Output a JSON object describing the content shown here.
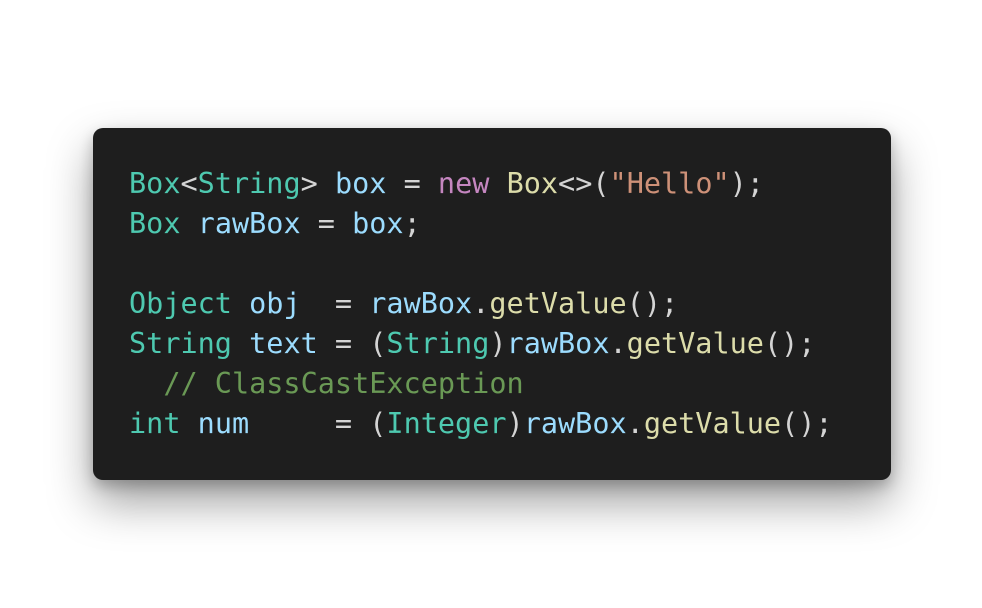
{
  "colors": {
    "background": "#1e1e1e",
    "type": "#4ec9b0",
    "variable": "#9cdcfe",
    "keyword": "#c586c0",
    "function": "#dcdcaa",
    "string": "#ce9178",
    "operator": "#d4d4d4",
    "comment": "#6a9955"
  },
  "code": {
    "lines": [
      [
        {
          "t": "Box",
          "k": "type"
        },
        {
          "t": "<",
          "k": "op"
        },
        {
          "t": "String",
          "k": "type"
        },
        {
          "t": "> ",
          "k": "op"
        },
        {
          "t": "box",
          "k": "var"
        },
        {
          "t": " = ",
          "k": "op"
        },
        {
          "t": "new",
          "k": "kw"
        },
        {
          "t": " ",
          "k": "op"
        },
        {
          "t": "Box",
          "k": "fn"
        },
        {
          "t": "<>(",
          "k": "op"
        },
        {
          "t": "\"Hello\"",
          "k": "str"
        },
        {
          "t": ");",
          "k": "op"
        }
      ],
      [
        {
          "t": "Box",
          "k": "type"
        },
        {
          "t": " ",
          "k": "op"
        },
        {
          "t": "rawBox",
          "k": "var"
        },
        {
          "t": " = ",
          "k": "op"
        },
        {
          "t": "box",
          "k": "var"
        },
        {
          "t": ";",
          "k": "op"
        }
      ],
      [],
      [
        {
          "t": "Object",
          "k": "type"
        },
        {
          "t": " ",
          "k": "op"
        },
        {
          "t": "obj",
          "k": "var"
        },
        {
          "t": "  = ",
          "k": "op"
        },
        {
          "t": "rawBox",
          "k": "var"
        },
        {
          "t": ".",
          "k": "op"
        },
        {
          "t": "getValue",
          "k": "fn"
        },
        {
          "t": "();",
          "k": "op"
        }
      ],
      [
        {
          "t": "String",
          "k": "type"
        },
        {
          "t": " ",
          "k": "op"
        },
        {
          "t": "text",
          "k": "var"
        },
        {
          "t": " = (",
          "k": "op"
        },
        {
          "t": "String",
          "k": "type"
        },
        {
          "t": ")",
          "k": "op"
        },
        {
          "t": "rawBox",
          "k": "var"
        },
        {
          "t": ".",
          "k": "op"
        },
        {
          "t": "getValue",
          "k": "fn"
        },
        {
          "t": "();",
          "k": "op"
        }
      ],
      [
        {
          "t": "  ",
          "k": "op"
        },
        {
          "t": "// ClassCastException",
          "k": "cmt"
        }
      ],
      [
        {
          "t": "int",
          "k": "type"
        },
        {
          "t": " ",
          "k": "op"
        },
        {
          "t": "num",
          "k": "var"
        },
        {
          "t": "     = (",
          "k": "op"
        },
        {
          "t": "Integer",
          "k": "type"
        },
        {
          "t": ")",
          "k": "op"
        },
        {
          "t": "rawBox",
          "k": "var"
        },
        {
          "t": ".",
          "k": "op"
        },
        {
          "t": "getValue",
          "k": "fn"
        },
        {
          "t": "();",
          "k": "op"
        }
      ]
    ]
  }
}
